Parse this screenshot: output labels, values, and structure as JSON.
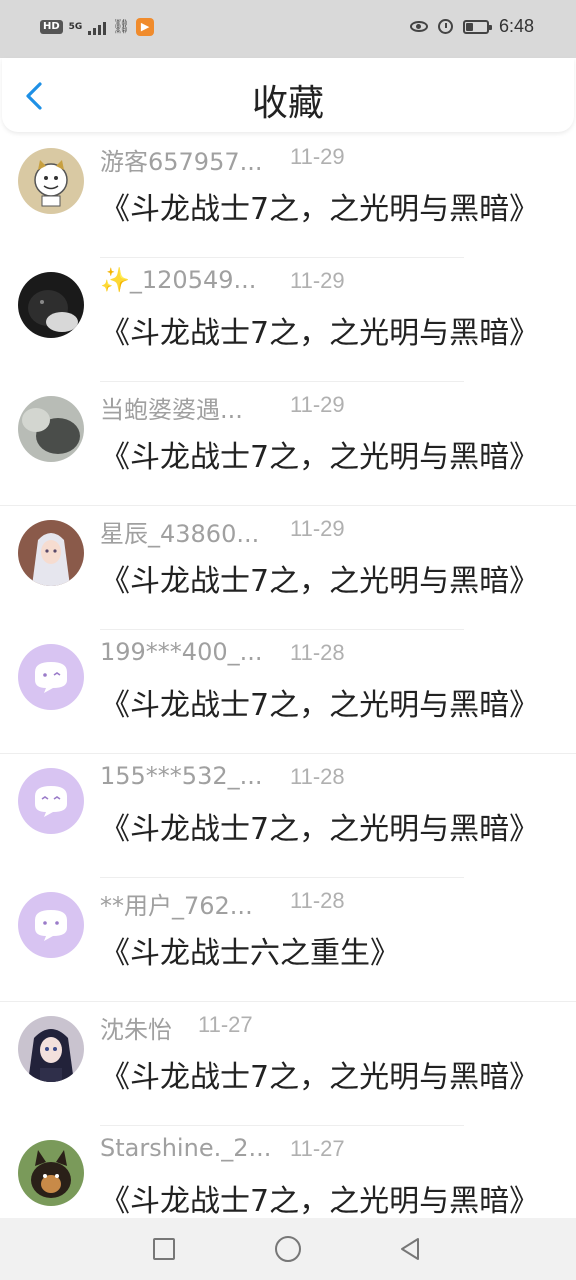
{
  "status_bar": {
    "hd": "HD",
    "network": "5G",
    "time": "6:48"
  },
  "header": {
    "title": "收藏",
    "back_icon": "chevron-left-icon",
    "accent": "#1e90e6"
  },
  "items": [
    {
      "name": "游客657957...",
      "date": "11-29",
      "text": "《斗龙战士7之，之光明与黑暗》",
      "avatar": "cartoon-cat-avatar"
    },
    {
      "name": "✨_120549...",
      "date": "11-29",
      "text": "《斗龙战士7之，之光明与黑暗》",
      "avatar": "cat-photo-avatar"
    },
    {
      "name": "当蚫婆婆遇...",
      "date": "11-29",
      "text": "《斗龙战士7之，之光明与黑暗》",
      "avatar": "gray-photo-avatar"
    },
    {
      "name": "星辰_43860...",
      "date": "11-29",
      "text": "《斗龙战士7之，之光明与黑暗》",
      "avatar": "anime-girl-avatar"
    },
    {
      "name": "199***400_...",
      "date": "11-28",
      "text": "《斗龙战士7之，之光明与黑暗》",
      "avatar": "default-chat-avatar"
    },
    {
      "name": "155***532_...",
      "date": "11-28",
      "text": "《斗龙战士7之，之光明与黑暗》",
      "avatar": "default-chat-avatar"
    },
    {
      "name": "**用户_762...",
      "date": "11-28",
      "text": "《斗龙战士六之重生》",
      "avatar": "default-chat-avatar"
    },
    {
      "name": "沈朱怡",
      "date": "11-27",
      "text": "《斗龙战士7之，之光明与黑暗》",
      "avatar": "anime-girl-dark-avatar"
    },
    {
      "name": "Starshine._2...",
      "date": "11-27",
      "text": "《斗龙战士7之，之光明与黑暗》",
      "avatar": "dog-photo-avatar"
    }
  ],
  "nav": {
    "recent_icon": "square-icon",
    "home_icon": "circle-icon",
    "back_icon": "triangle-back-icon"
  }
}
